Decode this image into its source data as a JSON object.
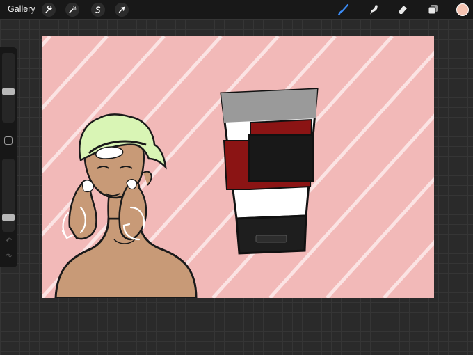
{
  "toolbar": {
    "gallery_label": "Gallery",
    "left_tools": [
      {
        "name": "actions",
        "icon": "wrench-icon"
      },
      {
        "name": "adjustments",
        "icon": "magic-wand-icon"
      },
      {
        "name": "selection",
        "icon": "selection-s-icon"
      },
      {
        "name": "transform",
        "icon": "arrow-cursor-icon"
      }
    ],
    "right_tools": [
      {
        "name": "brush",
        "icon": "brush-icon",
        "active": true
      },
      {
        "name": "smudge",
        "icon": "smudge-icon",
        "active": false
      },
      {
        "name": "eraser",
        "icon": "eraser-icon",
        "active": false
      },
      {
        "name": "layers",
        "icon": "layers-icon",
        "active": false
      }
    ],
    "active_tool_color": "#3b8bf5",
    "current_color": "#f6c4b2"
  },
  "sidebar": {
    "brush_size_level": 0.5,
    "opacity_level": 0.9,
    "undo_icon": "undo-icon",
    "redo_icon": "redo-icon"
  },
  "canvas": {
    "background_color": "#f2b9b8",
    "stripe_color": "#fbe3e3",
    "skin_color": "#c89a77",
    "hair_color": "#d9f5b5",
    "tube_colors": {
      "cap": "#1e1e1e",
      "top": "#9a9a9a",
      "red": "#8b1414",
      "label": "#181818"
    }
  }
}
